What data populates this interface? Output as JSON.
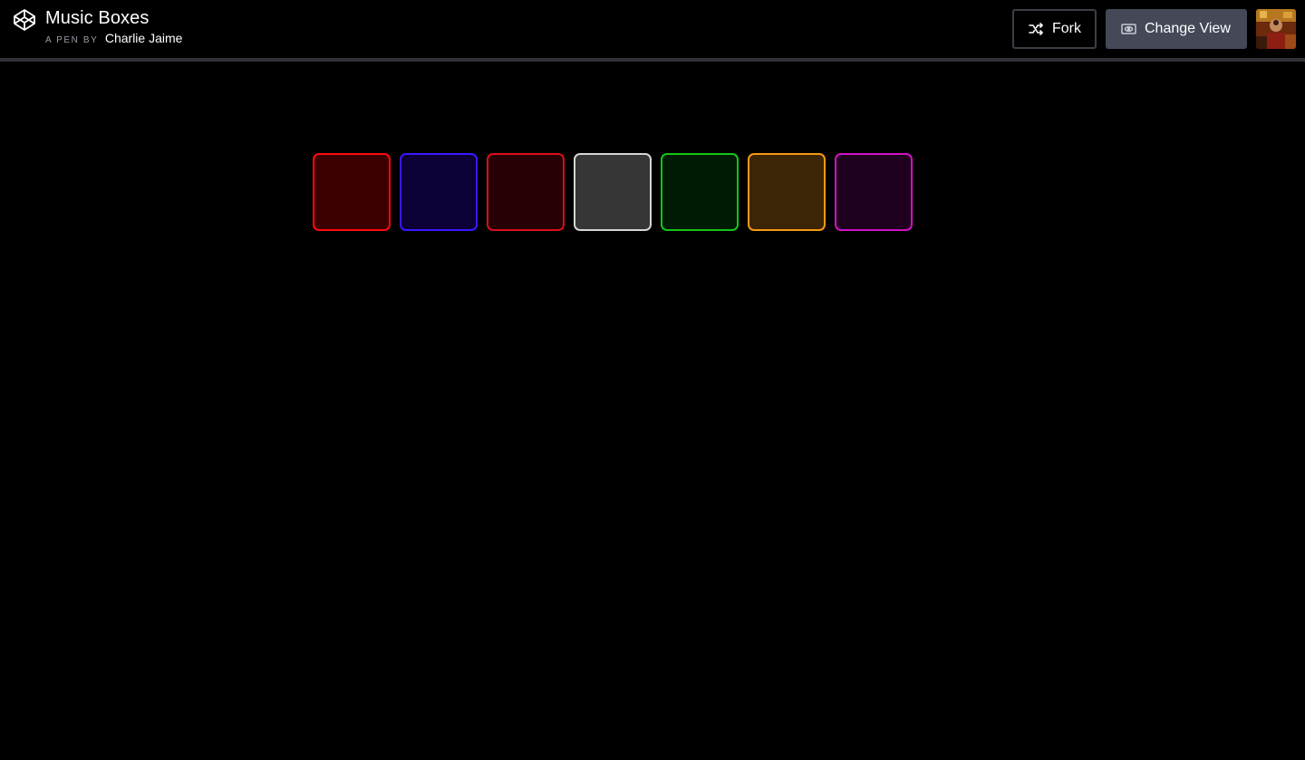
{
  "header": {
    "title": "Music Boxes",
    "byline_label": "A PEN BY",
    "author": "Charlie Jaime",
    "fork_label": "Fork",
    "change_view_label": "Change View",
    "logo_icon": "codepen-logo-icon",
    "fork_icon": "fork-icon",
    "change_view_icon": "eye-view-icon"
  },
  "boxes": [
    {
      "name": "music-box-red",
      "border": "#ff0a12",
      "fill": "#3d0000"
    },
    {
      "name": "music-box-blue",
      "border": "#3a17ff",
      "fill": "#0d0037"
    },
    {
      "name": "music-box-crimson",
      "border": "#d80f1a",
      "fill": "#270005"
    },
    {
      "name": "music-box-white",
      "border": "#d5d5d5",
      "fill": "#363636"
    },
    {
      "name": "music-box-green",
      "border": "#12c61a",
      "fill": "#001b03"
    },
    {
      "name": "music-box-orange",
      "border": "#f59a12",
      "fill": "#3b2506"
    },
    {
      "name": "music-box-magenta",
      "border": "#d111c6",
      "fill": "#1f001e"
    }
  ]
}
